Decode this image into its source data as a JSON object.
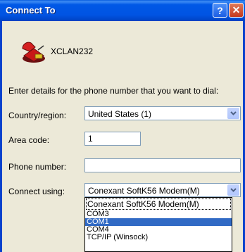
{
  "window": {
    "title": "Connect To",
    "help_button": "?",
    "close_button": "✕"
  },
  "connection": {
    "name": "XCLAN232",
    "icon": "phone-icon"
  },
  "instruction": "Enter details for the phone number that you want to dial:",
  "form": {
    "country_label": "Country/region:",
    "country_value": "United States (1)",
    "area_label": "Area code:",
    "area_value": "1",
    "phone_label": "Phone number:",
    "phone_value": "",
    "connect_label": "Connect using:",
    "connect_value": "Conexant SoftK56 Modem(M)"
  },
  "dropdown_options": [
    "Conexant SoftK56 Modem(M)",
    "COM3",
    "COM1",
    "COM4",
    "TCP/IP (Winsock)"
  ],
  "selected_option": "COM1",
  "colors": {
    "title_blue": "#0054e3",
    "selection": "#316ac5",
    "dialog_bg": "#ece9d8"
  }
}
